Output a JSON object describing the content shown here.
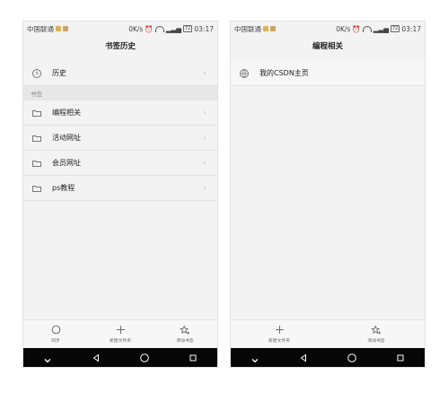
{
  "status": {
    "carrier": "中国联通",
    "speed": "0K/s",
    "time": "03:17",
    "battery": "72"
  },
  "left": {
    "title": "书签历史",
    "history_label": "历史",
    "section_label": "书签",
    "items": [
      {
        "label": "编程相关"
      },
      {
        "label": "活动网址"
      },
      {
        "label": "会员网址"
      },
      {
        "label": "ps教程"
      }
    ],
    "toolbar": {
      "sync": "同步",
      "new_folder": "新建文件夹",
      "add_bookmark": "添加书签"
    }
  },
  "right": {
    "title": "编程相关",
    "item": "我的CSDN主页",
    "toolbar": {
      "new_folder": "新建文件夹",
      "add_bookmark": "添加书签"
    }
  },
  "icons": {
    "history": "clock-icon",
    "folder": "folder-icon",
    "globe": "globe-icon",
    "arrow": "chevron-right-icon",
    "sync": "circle-icon",
    "new_folder": "plus-icon",
    "add_bookmark": "star-add-icon",
    "nav_down": "chevron-down-icon",
    "nav_back": "triangle-back-icon",
    "nav_home": "circle-home-icon",
    "nav_recent": "square-recent-icon"
  }
}
